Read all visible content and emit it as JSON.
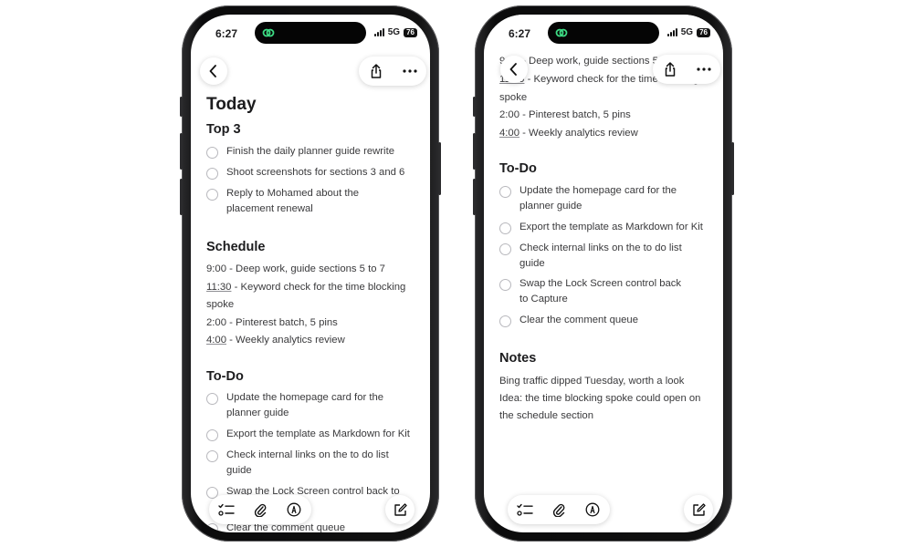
{
  "status": {
    "time": "6:27",
    "network": "5G",
    "battery": "76"
  },
  "left": {
    "title": "Today",
    "top3_heading": "Top 3",
    "top3": [
      "Finish the daily planner guide rewrite",
      "Shoot screenshots for sections 3 and 6",
      "Reply to Mohamed about the placement renewal"
    ],
    "schedule_heading": "Schedule",
    "schedule": [
      {
        "time": "9:00",
        "text": " - Deep work, guide sections 5 to 7"
      },
      {
        "time": "11:30",
        "text": " - Keyword check for the time blocking"
      },
      {
        "time": "",
        "text": "spoke"
      },
      {
        "time": "2:00",
        "text": " - Pinterest batch, 5 pins"
      },
      {
        "time": "4:00",
        "text": " - Weekly analytics review"
      }
    ],
    "todo_heading": "To-Do",
    "todos": [
      "Update the homepage card for the planner guide",
      "Export the template as Markdown for Kit",
      "Check internal links on the to do list guide",
      "Swap the Lock Screen control back to",
      "Clear the comment queue"
    ]
  },
  "right": {
    "schedule": [
      {
        "time": "9:00",
        "text": " - Deep work, guide sections 5"
      },
      {
        "time": "11:30",
        "text": " - Keyword check for the time blocking"
      },
      {
        "time": "",
        "text": "spoke"
      },
      {
        "time": "2:00",
        "text": " - Pinterest batch, 5 pins"
      },
      {
        "time": "4:00",
        "text": " - Weekly analytics review"
      }
    ],
    "todo_heading": "To-Do",
    "todos": [
      "Update the homepage card for the planner guide",
      "Export the template as Markdown for Kit",
      "Check internal links on the to do list guide",
      "Swap the Lock Screen control back to Capture",
      "Clear the comment queue"
    ],
    "notes_heading": "Notes",
    "notes": [
      "Bing traffic dipped Tuesday, worth a look",
      "Idea: the time blocking spoke could open on",
      "the schedule section"
    ]
  },
  "icons": {
    "back": "chevron-left-icon",
    "share": "share-icon",
    "more": "more-icon",
    "checklist": "checklist-icon",
    "attach": "paperclip-icon",
    "markup": "pen-icon",
    "compose": "compose-icon",
    "app": "link-app-icon"
  },
  "colors": {
    "app_icon": "#3ddc84",
    "text": "#3a3a3c",
    "heading": "#1c1c1e"
  }
}
